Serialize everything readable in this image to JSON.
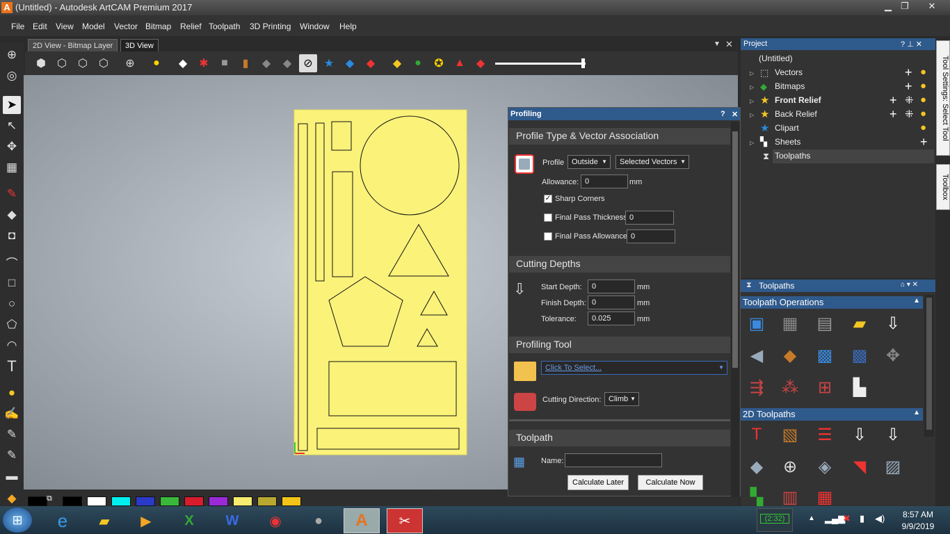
{
  "window": {
    "title": "(Untitled) - Autodesk ArtCAM Premium 2017",
    "app_icon": "A",
    "min": "▁",
    "max": "❐",
    "close": "✕"
  },
  "menu": [
    "File",
    "Edit",
    "View",
    "Model",
    "Vector",
    "Bitmap",
    "Relief",
    "Toolpath",
    "3D Printing",
    "Window",
    "Help"
  ],
  "tabs": {
    "tab1": "2D View - Bitmap Layer",
    "tab2": "3D View"
  },
  "profiling": {
    "title": "Profiling",
    "help": "?",
    "close": "✕",
    "sec_profile": "Profile Type & Vector Association",
    "profile_label": "Profile",
    "profile_value": "Outside",
    "vectors_value": "Selected Vectors",
    "allowance_label": "Allowance:",
    "allowance_value": "0",
    "allowance_unit": "mm",
    "sharp_corners": "Sharp Corners",
    "sharp_check": "✓",
    "final_pass_thickness": "Final Pass Thickness",
    "fpt_value": "0",
    "final_pass_allowance": "Final Pass Allowance",
    "fpa_value": "0",
    "sec_depths": "Cutting Depths",
    "start_depth_label": "Start Depth:",
    "start_depth": "0",
    "finish_depth_label": "Finish Depth:",
    "finish_depth": "0",
    "tolerance_label": "Tolerance:",
    "tolerance": "0.025",
    "mm": "mm",
    "sec_tool": "Profiling Tool",
    "tool_select": "Click To Select...",
    "cut_dir_label": "Cutting Direction:",
    "cut_dir": "Climb",
    "sec_toolpath": "Toolpath",
    "name_label": "Name:",
    "name_value": "",
    "calc_later": "Calculate Later",
    "calc_now": "Calculate Now"
  },
  "project": {
    "title": "Project",
    "hdr_icons": "? ⊥ ✕",
    "root": "(Untitled)",
    "items": [
      "Vectors",
      "Bitmaps",
      "Front Relief",
      "Back Relief",
      "Clipart",
      "Sheets",
      "Toolpaths"
    ]
  },
  "toolpaths_panel": {
    "title": "Toolpaths",
    "ops": "Toolpath Operations",
    "twod": "2D Toolpaths"
  },
  "side_tabs": {
    "tool_settings": "Tool Settings: Select Tool",
    "toolbox": "Toolbox"
  },
  "taskbar": {
    "battery": "(2:32)",
    "time": "8:57 AM",
    "date": "9/9/2019"
  },
  "colors": {
    "accent": "#2f5a8c",
    "sheet": "#fbf27a"
  }
}
